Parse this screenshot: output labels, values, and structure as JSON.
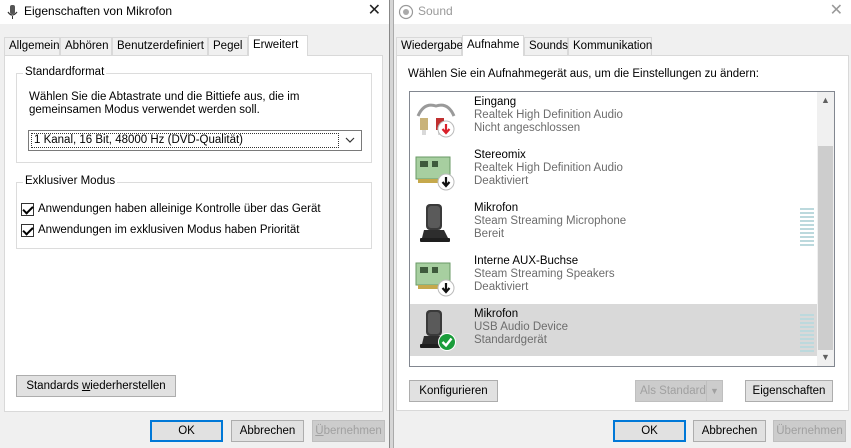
{
  "left": {
    "title": "Eigenschaften von Mikrofon",
    "tabs": [
      "Allgemein",
      "Abhören",
      "Benutzerdefiniert",
      "Pegel",
      "Erweitert"
    ],
    "active_tab": "Erweitert",
    "standardformat": {
      "label": "Standardformat",
      "description_line1": "Wählen Sie die Abtastrate und die Bittiefe aus, die im",
      "description_line2": "gemeinsamen Modus verwendet werden soll.",
      "selected_format": "1 Kanal, 16 Bit, 48000 Hz (DVD-Qualität)"
    },
    "exclusive": {
      "label": "Exklusiver Modus",
      "option1": "Anwendungen haben alleinige Kontrolle über das Gerät",
      "option1_checked": true,
      "option2": "Anwendungen im exklusiven Modus haben Priorität",
      "option2_checked": true
    },
    "restore_prefix": "Standards ",
    "restore_underlined": "w",
    "restore_suffix": "iederherstellen",
    "ok": "OK",
    "cancel": "Abbrechen",
    "apply_underlined": "Ü",
    "apply_suffix": "bernehmen"
  },
  "right": {
    "title": "Sound",
    "tabs": [
      "Wiedergabe",
      "Aufnahme",
      "Sounds",
      "Kommunikation"
    ],
    "active_tab": "Aufnahme",
    "instruction": "Wählen Sie ein Aufnahmegerät aus, um die Einstellungen zu ändern:",
    "devices": [
      {
        "name": "Eingang",
        "driver": "Realtek High Definition Audio",
        "status": "Nicht angeschlossen",
        "icon": "line-in-cable-icon",
        "badge": "red-down-arrow"
      },
      {
        "name": "Stereomix",
        "driver": "Realtek High Definition Audio",
        "status": "Deaktiviert",
        "icon": "sound-card-icon",
        "badge": "black-down-arrow"
      },
      {
        "name": "Mikrofon",
        "driver": "Steam Streaming Microphone",
        "status": "Bereit",
        "icon": "microphone-icon",
        "badge": "none"
      },
      {
        "name": "Interne AUX-Buchse",
        "driver": "Steam Streaming Speakers",
        "status": "Deaktiviert",
        "icon": "sound-card-icon",
        "badge": "black-down-arrow"
      },
      {
        "name": "Mikrofon",
        "driver": "USB Audio Device",
        "status": "Standardgerät",
        "icon": "microphone-icon",
        "badge": "green-check",
        "selected": true
      }
    ],
    "configure": "Konfigurieren",
    "set_default": "Als Standard",
    "properties": "Eigenschaften",
    "ok": "OK",
    "cancel": "Abbrechen",
    "apply": "Übernehmen"
  },
  "colors": {
    "accent": "#0078d7",
    "selected_row": "#d9d9d9",
    "meter": "#bcd9dd",
    "status_text": "#6d6d6d"
  }
}
